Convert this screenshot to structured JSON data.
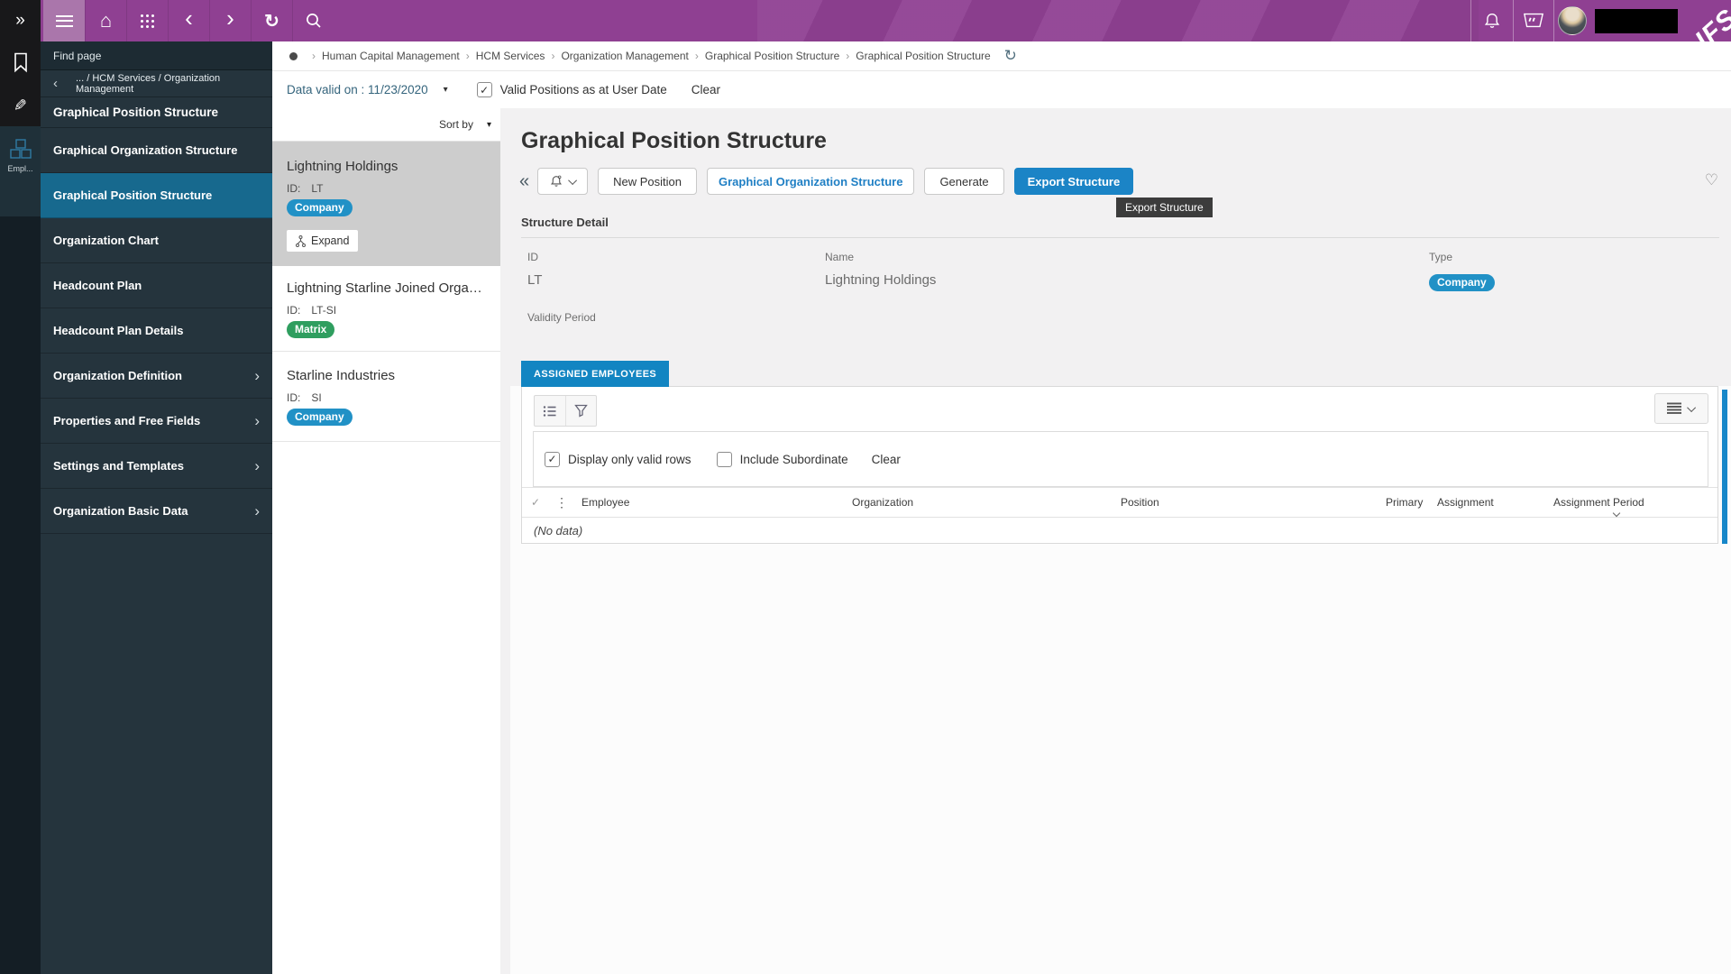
{
  "colors": {
    "topbar_purple": "#8f4092",
    "nav_active": "#17698e",
    "primary_button": "#1b84c6",
    "tab_blue": "#1285c2",
    "badge_company": "#2191c6",
    "badge_matrix": "#2f9e5f"
  },
  "topbar": {
    "logo": "IFS"
  },
  "rail": {
    "module_label": "Empl..."
  },
  "sidebar": {
    "find_page": "Find page",
    "back_path": "... / HCM Services / Organization Management",
    "header": "Graphical Position Structure",
    "items": [
      {
        "label": "Graphical Organization Structure"
      },
      {
        "label": "Graphical Position Structure"
      },
      {
        "label": "Organization Chart"
      },
      {
        "label": "Headcount Plan"
      },
      {
        "label": "Headcount Plan Details"
      },
      {
        "label": "Organization Definition"
      },
      {
        "label": "Properties and Free Fields"
      },
      {
        "label": "Settings and Templates"
      },
      {
        "label": "Organization Basic Data"
      }
    ]
  },
  "breadcrumb": {
    "items": [
      "Human Capital Management",
      "HCM Services",
      "Organization Management",
      "Graphical Position Structure",
      "Graphical Position Structure"
    ]
  },
  "filter_bar": {
    "data_valid_label": "Data valid on : 11/23/2020",
    "valid_positions_label": "Valid Positions as at User Date",
    "clear_label": "Clear"
  },
  "org_list": {
    "sort_label": "Sort by",
    "cards": [
      {
        "title": "Lightning Holdings",
        "id_label": "ID:",
        "id": "LT",
        "badge": "Company",
        "expand_label": "Expand"
      },
      {
        "title": "Lightning Starline Joined Organiz...",
        "id_label": "ID:",
        "id": "LT-SI",
        "badge": "Matrix"
      },
      {
        "title": "Starline Industries",
        "id_label": "ID:",
        "id": "SI",
        "badge": "Company"
      }
    ]
  },
  "page": {
    "title": "Graphical Position Structure",
    "toolbar": {
      "new_position": "New Position",
      "graphical_org_structure": "Graphical Organization Structure",
      "generate": "Generate",
      "export_structure": "Export Structure"
    },
    "tooltip": "Export Structure",
    "structure_detail": {
      "heading": "Structure Detail",
      "id_label": "ID",
      "id_value": "LT",
      "name_label": "Name",
      "name_value": "Lightning Holdings",
      "type_label": "Type",
      "type_badge": "Company",
      "validity_label": "Validity Period"
    },
    "tab": "ASSIGNED EMPLOYEES",
    "table": {
      "display_only_valid_rows": "Display only valid rows",
      "include_subordinate": "Include Subordinate",
      "clear": "Clear",
      "columns": [
        "Employee",
        "Organization",
        "Position",
        "Primary",
        "Assignment",
        "Assignment Period"
      ],
      "no_data": "(No data)"
    }
  }
}
